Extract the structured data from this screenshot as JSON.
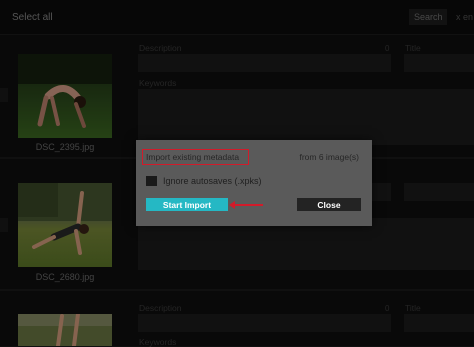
{
  "toolbar": {
    "select_all_label": "Select all",
    "search_placeholder": "Search",
    "search_extra": "x en"
  },
  "cards": [
    {
      "filename": "DSC_2395.jpg",
      "description_label": "Description",
      "description_count": "0",
      "title_label": "Title",
      "keywords_label": "Keywords"
    },
    {
      "filename": "DSC_2680.jpg"
    },
    {
      "description_label": "Description",
      "description_count": "0",
      "title_label": "Title",
      "keywords_label": "Keywords"
    }
  ],
  "modal": {
    "title": "Import existing metadata",
    "from_text": "from 6 image(s)",
    "checkbox_label": "Ignore autosaves (.xpks)",
    "checkbox_checked": false,
    "start_button": "Start Import",
    "close_button": "Close"
  },
  "colors": {
    "accent": "#25b8c4",
    "highlight": "#d21b2a",
    "dialog_bg": "#5a5a5a"
  }
}
